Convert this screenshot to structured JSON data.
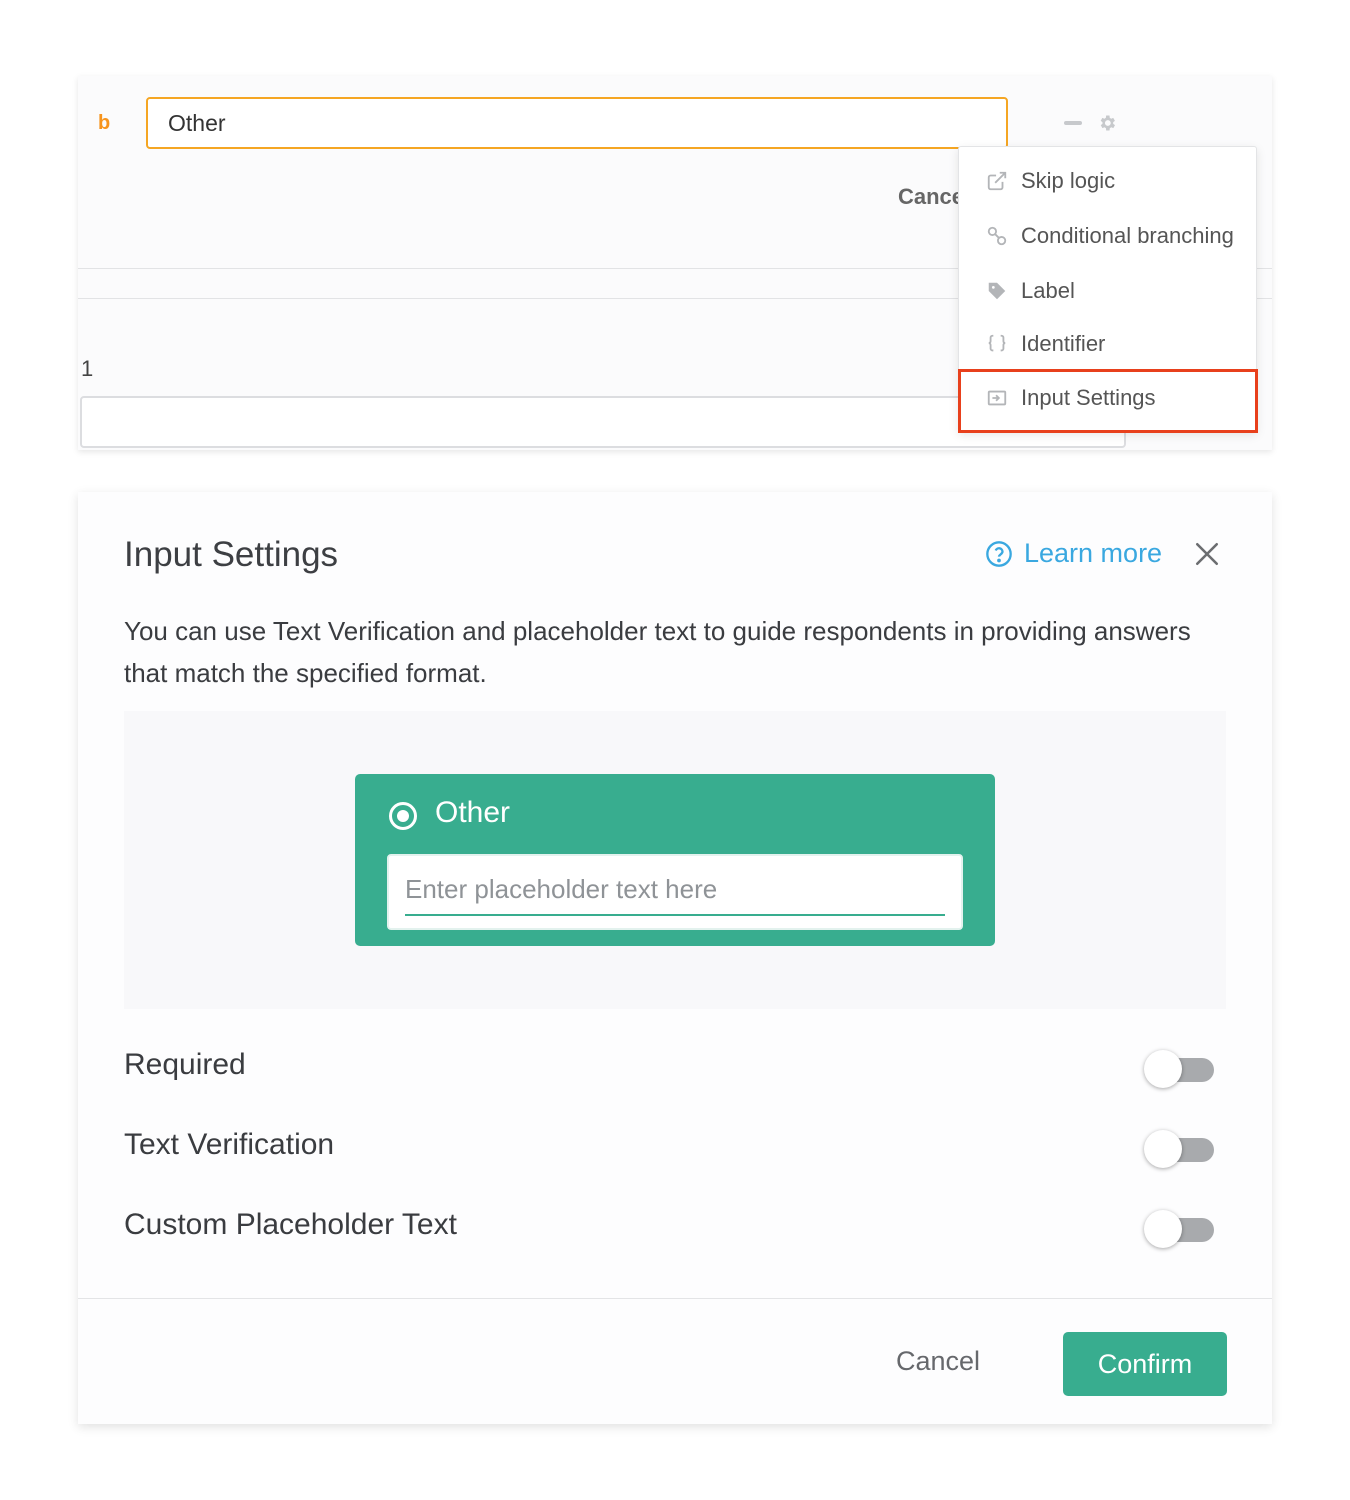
{
  "editor": {
    "option_letter": "b",
    "option_value": "Other",
    "cancel_partial": "Cancel",
    "row_number": "1"
  },
  "dropdown": {
    "items": [
      {
        "label": "Skip logic",
        "icon": "external-link-icon"
      },
      {
        "label": "Conditional branching",
        "icon": "link-icon"
      },
      {
        "label": "Label",
        "icon": "tag-icon"
      },
      {
        "label": "Identifier",
        "icon": "braces-icon"
      },
      {
        "label": "Input Settings",
        "icon": "input-settings-icon"
      }
    ],
    "highlighted": "Input Settings",
    "highlight_color": "#e8401c"
  },
  "modal": {
    "title": "Input Settings",
    "learn_more": "Learn more",
    "description": "You can use Text Verification and placeholder text to guide respondents in providing answers that match the specified format.",
    "preview": {
      "option_label": "Other",
      "placeholder": "Enter placeholder text here"
    },
    "settings": [
      {
        "label": "Required",
        "enabled": false
      },
      {
        "label": "Text Verification",
        "enabled": false
      },
      {
        "label": "Custom Placeholder Text",
        "enabled": false
      }
    ],
    "cancel_label": "Cancel",
    "confirm_label": "Confirm"
  },
  "colors": {
    "accent": "#38ad8f",
    "link": "#3aa8e0",
    "input_focus": "#f5a623",
    "letter": "#f7941d"
  }
}
